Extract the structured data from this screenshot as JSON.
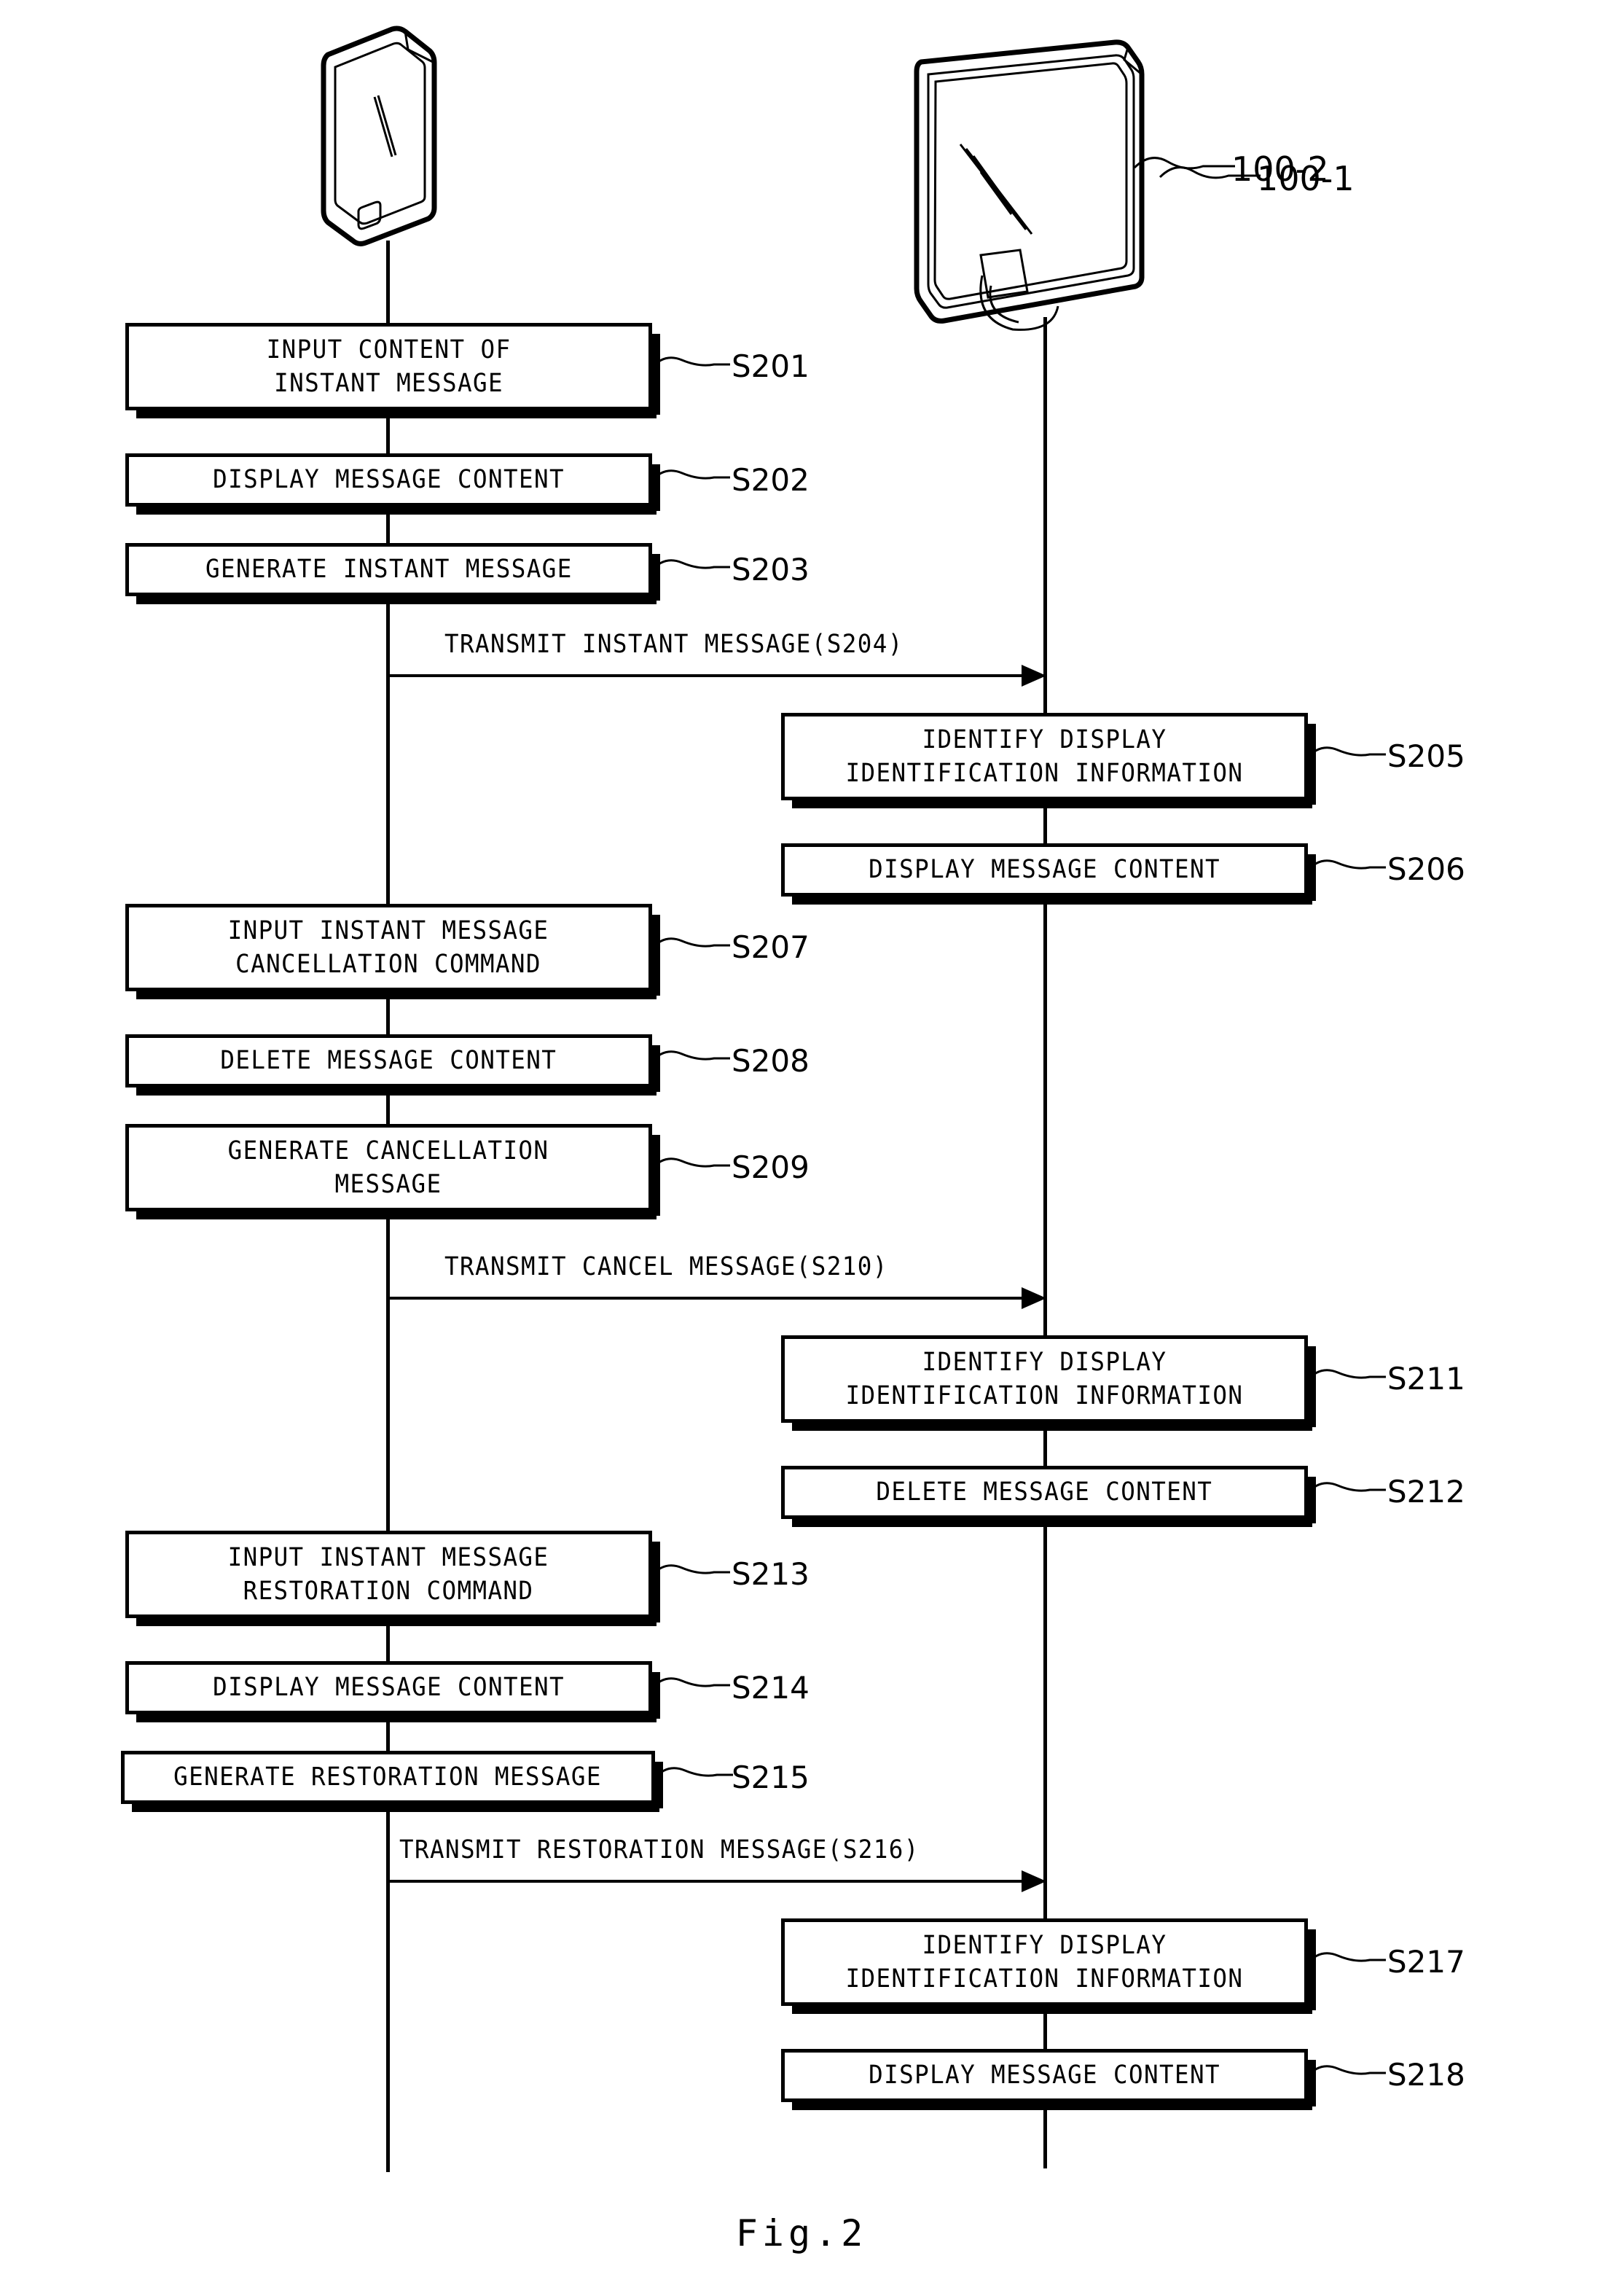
{
  "figure": {
    "caption": "Fig.2",
    "type": "sequence-diagram"
  },
  "actors": [
    {
      "id": "mobile",
      "label": "100-1",
      "icon": "smartphone-icon",
      "lane": "left"
    },
    {
      "id": "tv",
      "label": "100-2",
      "icon": "television-icon",
      "lane": "right"
    }
  ],
  "steps": [
    {
      "id": "S201",
      "lane": "left",
      "text": "INPUT CONTENT OF\nINSTANT MESSAGE",
      "ref": "S201"
    },
    {
      "id": "S202",
      "lane": "left",
      "text": "DISPLAY MESSAGE CONTENT",
      "ref": "S202"
    },
    {
      "id": "S203",
      "lane": "left",
      "text": "GENERATE INSTANT MESSAGE",
      "ref": "S203"
    },
    {
      "id": "S205",
      "lane": "right",
      "text": "IDENTIFY DISPLAY\nIDENTIFICATION INFORMATION",
      "ref": "S205"
    },
    {
      "id": "S206",
      "lane": "right",
      "text": "DISPLAY MESSAGE CONTENT",
      "ref": "S206"
    },
    {
      "id": "S207",
      "lane": "left",
      "text": "INPUT INSTANT MESSAGE\nCANCELLATION COMMAND",
      "ref": "S207"
    },
    {
      "id": "S208",
      "lane": "left",
      "text": "DELETE MESSAGE CONTENT",
      "ref": "S208"
    },
    {
      "id": "S209",
      "lane": "left",
      "text": "GENERATE CANCELLATION\nMESSAGE",
      "ref": "S209"
    },
    {
      "id": "S211",
      "lane": "right",
      "text": "IDENTIFY DISPLAY\nIDENTIFICATION INFORMATION",
      "ref": "S211"
    },
    {
      "id": "S212",
      "lane": "right",
      "text": "DELETE MESSAGE CONTENT",
      "ref": "S212"
    },
    {
      "id": "S213",
      "lane": "left",
      "text": "INPUT INSTANT MESSAGE\nRESTORATION COMMAND",
      "ref": "S213"
    },
    {
      "id": "S214",
      "lane": "left",
      "text": "DISPLAY MESSAGE CONTENT",
      "ref": "S214"
    },
    {
      "id": "S215",
      "lane": "left",
      "text": "GENERATE RESTORATION MESSAGE",
      "ref": "S215"
    },
    {
      "id": "S217",
      "lane": "right",
      "text": "IDENTIFY DISPLAY\nIDENTIFICATION INFORMATION",
      "ref": "S217"
    },
    {
      "id": "S218",
      "lane": "right",
      "text": "DISPLAY MESSAGE CONTENT",
      "ref": "S218"
    }
  ],
  "messages": [
    {
      "id": "S204",
      "label": "TRANSMIT INSTANT MESSAGE(S204)",
      "from": "mobile",
      "to": "tv"
    },
    {
      "id": "S210",
      "label": "TRANSMIT CANCEL MESSAGE(S210)",
      "from": "mobile",
      "to": "tv"
    },
    {
      "id": "S216",
      "label": "TRANSMIT RESTORATION MESSAGE(S216)",
      "from": "mobile",
      "to": "tv"
    }
  ],
  "colors": {
    "ink": "#000000",
    "paper": "#ffffff"
  }
}
